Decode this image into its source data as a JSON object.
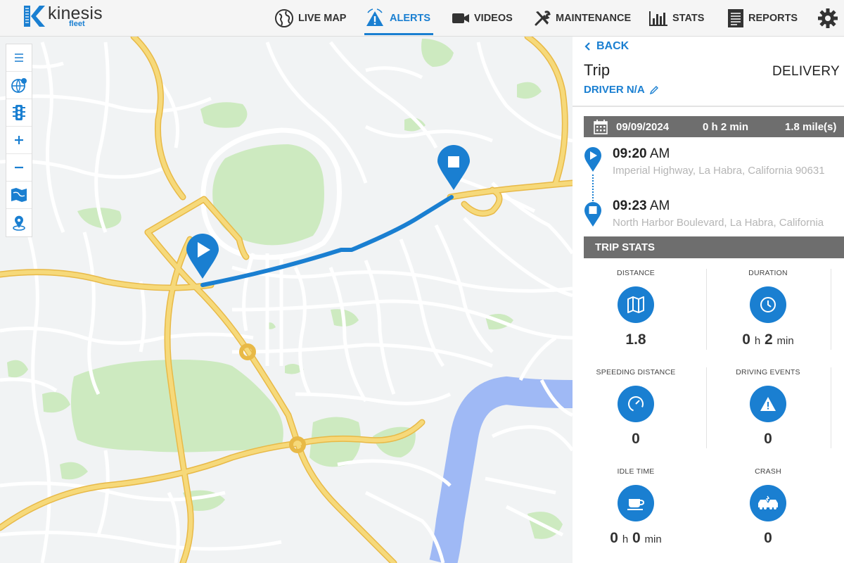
{
  "brand": {
    "name": "kinesis",
    "sub": "fleet"
  },
  "nav": {
    "live_map": "LIVE MAP",
    "alerts": "ALERTS",
    "videos": "VIDEOS",
    "maintenance": "MAINTENANCE",
    "stats": "STATS",
    "reports": "REPORTS"
  },
  "panel": {
    "back": "BACK",
    "title": "Trip",
    "type": "DELIVERY",
    "driver": "DRIVER N/A",
    "summary": {
      "date": "09/09/2024",
      "duration": "0 h 2 min",
      "distance": "1.8 mile(s)"
    },
    "start": {
      "time": "09:20",
      "ampm": "AM",
      "address": "Imperial Highway, La Habra, California 90631"
    },
    "end": {
      "time": "09:23",
      "ampm": "AM",
      "address": "North Harbor Boulevard, La Habra, California"
    },
    "stats_header": "TRIP STATS",
    "stats": {
      "distance": {
        "label": "DISTANCE",
        "value": "1.8"
      },
      "duration": {
        "label": "DURATION",
        "h": "0",
        "h_unit": "h",
        "m": "2",
        "m_unit": "min"
      },
      "speeding": {
        "label": "SPEEDING DISTANCE",
        "value": "0"
      },
      "events": {
        "label": "DRIVING EVENTS",
        "value": "0"
      },
      "idle": {
        "label": "IDLE TIME",
        "h": "0",
        "h_unit": "h",
        "m": "0",
        "m_unit": "min"
      },
      "crash": {
        "label": "CRASH",
        "value": "0"
      }
    }
  },
  "colors": {
    "accent": "#1a7fd1",
    "route": "#1a7fd1",
    "road_major": "#f6cf65",
    "park": "#cdeac0",
    "water": "#9fb9f5"
  }
}
